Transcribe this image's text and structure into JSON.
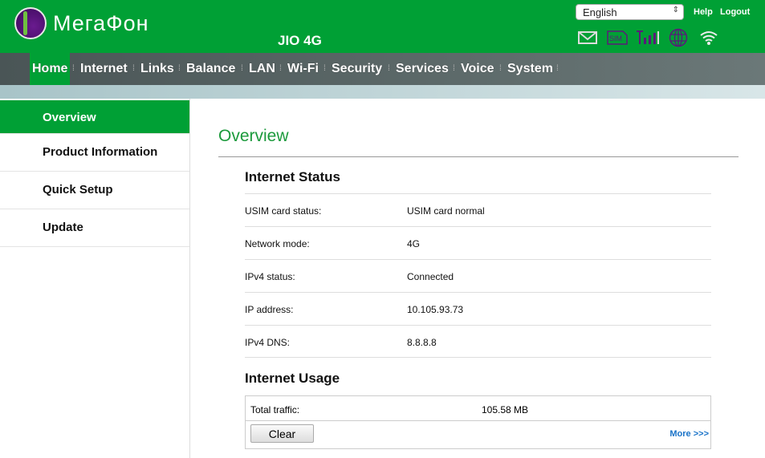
{
  "header": {
    "brand": "МегаФон",
    "model": "JIO 4G",
    "language": "English",
    "help": "Help",
    "logout": "Logout",
    "status_icons": [
      "mail-icon",
      "sim-icon",
      "signal-icon",
      "globe-icon",
      "wifi-icon"
    ],
    "sim_text": "SIM"
  },
  "nav": [
    "Home",
    "Internet",
    "Links",
    "Balance",
    "LAN",
    "Wi-Fi",
    "Security",
    "Services",
    "Voice",
    "System"
  ],
  "sidebar": [
    "Overview",
    "Product Information",
    "Quick Setup",
    "Update"
  ],
  "main": {
    "title": "Overview",
    "status_heading": "Internet Status",
    "rows": [
      {
        "label": "USIM card status:",
        "value": "USIM card normal"
      },
      {
        "label": "Network mode:",
        "value": "4G"
      },
      {
        "label": "IPv4 status:",
        "value": "Connected"
      },
      {
        "label": "IP address:",
        "value": "10.105.93.73"
      },
      {
        "label": "IPv4 DNS:",
        "value": "8.8.8.8"
      }
    ],
    "usage_heading": "Internet Usage",
    "total_label": "Total traffic:",
    "total_value": "105.58 MB",
    "clear": "Clear",
    "more": "More >>>"
  },
  "colors": {
    "brand_green": "#00a035",
    "link": "#1a73c8"
  }
}
